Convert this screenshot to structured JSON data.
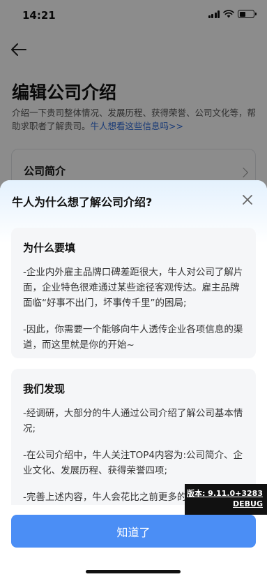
{
  "status_bar": {
    "time": "14:21"
  },
  "page": {
    "title": "编辑公司介绍",
    "description": "介绍一下贵司整体情况、发展历程、获得荣誉、公司文化等，帮助求职者了解贵司。",
    "description_link": "牛人想看这些信息吗>>",
    "card_title": "公司简介"
  },
  "sheet": {
    "title": "牛人为什么想了解公司介绍?",
    "sections": [
      {
        "heading": "为什么要填",
        "paragraphs": [
          "-企业内外雇主品牌口碑差距很大，牛人对公司了解片面，企业特色很难通过某些途径客观传达。雇主品牌面临“好事不出门，坏事传千里”的困局;",
          "-因此，你需要一个能够向牛人透传企业各项信息的渠道，而这里就是你的开始~"
        ]
      },
      {
        "heading": "我们发现",
        "paragraphs": [
          "-经调研，大部分的牛人通过公司介绍了解公司基本情况;",
          "-在公司介绍中，牛人关注TOP4内容为:公司简介、企业文化、发展历程、获得荣誉四项;",
          "-完善上述内容，牛人会花比之前更多的时间浏览您的招聘内容，进而和您进一步沟通"
        ]
      }
    ],
    "confirm_label": "知道了"
  },
  "debug": {
    "version": "版本: 9.11.0+3283",
    "mode": "DEBUG"
  },
  "colors": {
    "primary": "#4b8ef5",
    "link": "#2f6ad8",
    "sheet_gradient": "#e4f1fd"
  },
  "icons": [
    "back-arrow-icon",
    "chevron-right-icon",
    "close-icon",
    "wifi-icon",
    "battery-icon",
    "signal-icon"
  ]
}
